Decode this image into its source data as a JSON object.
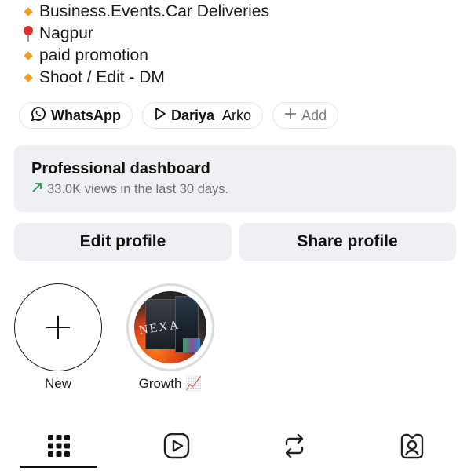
{
  "bio": {
    "lines": [
      {
        "icon": "orange-diamond-icon",
        "text": "Business.Events.Car Deliveries"
      },
      {
        "icon": "round-pushpin-icon",
        "text": "Nagpur"
      },
      {
        "icon": "orange-diamond-icon",
        "text": "paid promotion"
      },
      {
        "icon": "orange-diamond-icon",
        "text": "Shoot / Edit - DM"
      }
    ]
  },
  "chips": {
    "whatsapp": "WhatsApp",
    "dariya_strong": "Dariya",
    "dariya_rest": "Arko",
    "add": "Add"
  },
  "dashboard": {
    "title": "Professional dashboard",
    "subtitle": "33.0K views in the last 30 days."
  },
  "buttons": {
    "edit": "Edit profile",
    "share": "Share profile"
  },
  "highlights": {
    "new_label": "New",
    "growth_label": "Growth 📈",
    "cover_text": "NEXA"
  },
  "tabs": [
    {
      "name": "grid",
      "selected": true
    },
    {
      "name": "reels",
      "selected": false
    },
    {
      "name": "reposts",
      "selected": false
    },
    {
      "name": "tagged",
      "selected": false
    }
  ],
  "colors": {
    "accent_orange": "#f39c1f",
    "trend_green": "#1a9c57",
    "button_bg": "#eff0f3"
  }
}
